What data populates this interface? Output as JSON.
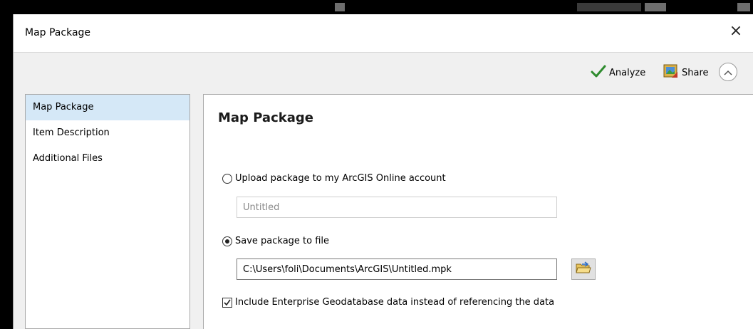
{
  "window": {
    "title": "Map Package",
    "close_glyph": "×"
  },
  "toolbar": {
    "analyze_label": "Analyze",
    "share_label": "Share"
  },
  "sidebar": {
    "items": [
      {
        "label": "Map Package",
        "selected": true
      },
      {
        "label": "Item Description",
        "selected": false
      },
      {
        "label": "Additional Files",
        "selected": false
      }
    ]
  },
  "main": {
    "title": "Map Package",
    "upload_option": {
      "label": "Upload package to my ArcGIS Online account",
      "checked": false
    },
    "upload_name": {
      "value": "Untitled"
    },
    "save_option": {
      "label": "Save package to file",
      "checked": true
    },
    "file_path": {
      "value": "C:\\Users\\foli\\Documents\\ArcGIS\\Untitled.mpk"
    },
    "include_option": {
      "label": "Include Enterprise Geodatabase data instead of referencing the data",
      "checked": true
    }
  },
  "colors": {
    "selected_item": "#d5e8f7",
    "analyze_check": "#2e8b2e"
  }
}
